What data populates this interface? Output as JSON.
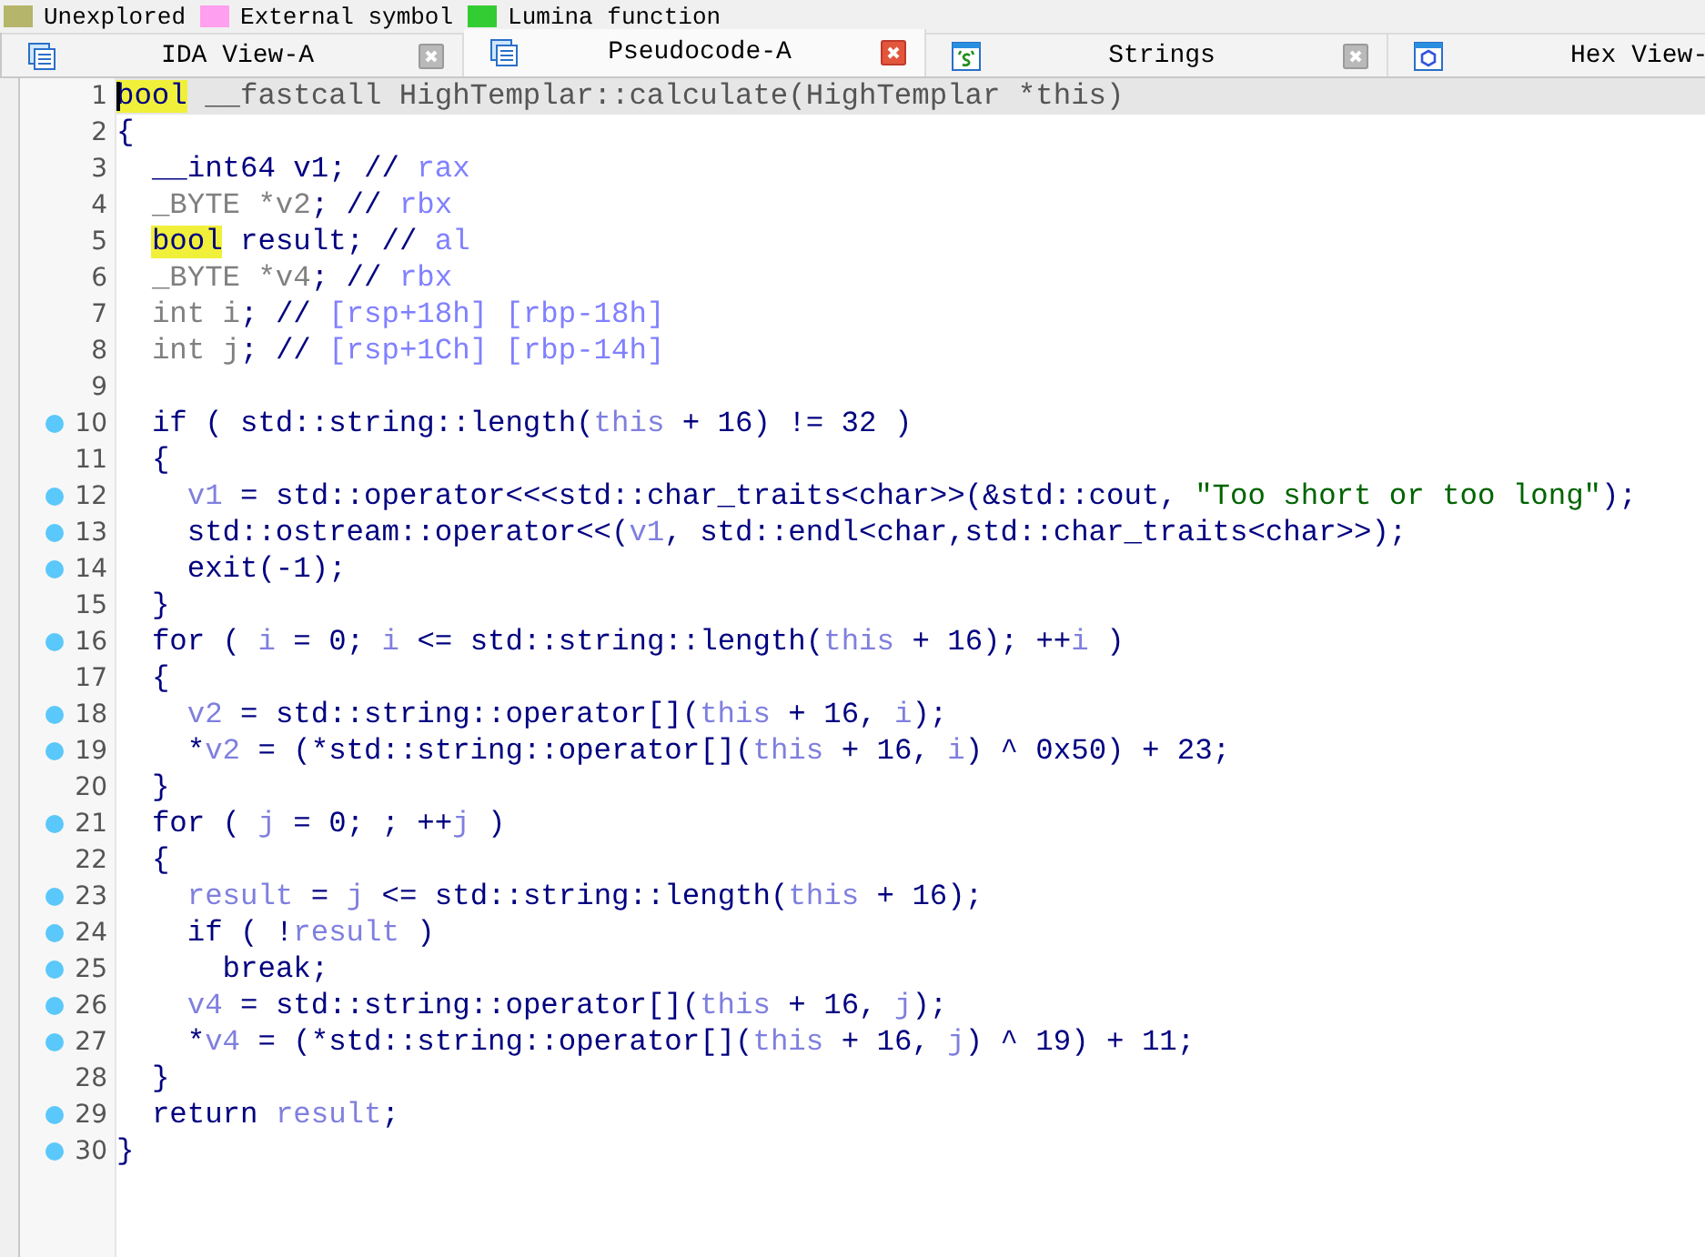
{
  "legend": [
    {
      "label": "Unexplored",
      "color": "#b5b56b"
    },
    {
      "label": "External symbol",
      "color": "#ff9fef"
    },
    {
      "label": "Lumina function",
      "color": "#33cc33"
    }
  ],
  "tabs": [
    {
      "label": "IDA View-A",
      "kind": "view",
      "selected": false,
      "close_button": true
    },
    {
      "label": "Pseudocode-A",
      "kind": "pseudocode",
      "selected": true,
      "close_button": true
    },
    {
      "label": "Strings",
      "kind": "strings",
      "selected": false,
      "close_button": true
    },
    {
      "label": "Hex View-",
      "kind": "hex",
      "selected": false,
      "close_button": false
    }
  ],
  "code_lines": [
    {
      "number": "1",
      "breakpoint": false,
      "selected": true,
      "segments": [
        {
          "kind": "highlight",
          "text": "bool"
        },
        {
          "kind": "decl",
          "text": " __fastcall HighTemplar::calculate(HighTemplar *this)"
        }
      ]
    },
    {
      "number": "2",
      "breakpoint": false,
      "selected": false,
      "segments": [
        {
          "kind": "plain",
          "text": "{"
        }
      ]
    },
    {
      "number": "3",
      "breakpoint": false,
      "selected": false,
      "segments": [
        {
          "kind": "plain",
          "text": "  __int64 v1; // "
        },
        {
          "kind": "comment",
          "text": "rax"
        }
      ]
    },
    {
      "number": "4",
      "breakpoint": false,
      "selected": false,
      "segments": [
        {
          "kind": "type",
          "text": "  _BYTE *v2"
        },
        {
          "kind": "plain",
          "text": "; // "
        },
        {
          "kind": "comment",
          "text": "rbx"
        }
      ]
    },
    {
      "number": "5",
      "breakpoint": false,
      "selected": false,
      "segments": [
        {
          "kind": "highlight",
          "text": "  bool"
        },
        {
          "kind": "plain",
          "text": " result; // "
        },
        {
          "kind": "comment",
          "text": "al"
        }
      ]
    },
    {
      "number": "6",
      "breakpoint": false,
      "selected": false,
      "segments": [
        {
          "kind": "type",
          "text": "  _BYTE *v4"
        },
        {
          "kind": "plain",
          "text": "; // "
        },
        {
          "kind": "comment",
          "text": "rbx"
        }
      ]
    },
    {
      "number": "7",
      "breakpoint": false,
      "selected": false,
      "segments": [
        {
          "kind": "type",
          "text": "  int i"
        },
        {
          "kind": "plain",
          "text": "; // "
        },
        {
          "kind": "comment",
          "text": "[rsp+18h] [rbp-18h]"
        }
      ]
    },
    {
      "number": "8",
      "breakpoint": false,
      "selected": false,
      "segments": [
        {
          "kind": "type",
          "text": "  int j"
        },
        {
          "kind": "plain",
          "text": "; // "
        },
        {
          "kind": "comment",
          "text": "[rsp+1Ch] [rbp-14h]"
        }
      ]
    },
    {
      "number": "9",
      "breakpoint": false,
      "selected": false
    },
    {
      "number": "10",
      "breakpoint": true,
      "selected": false,
      "segments": [
        {
          "kind": "plain",
          "text": "  if ( std::string::length("
        },
        {
          "kind": "var",
          "text": "this"
        },
        {
          "kind": "plain",
          "text": " + 16) != 32 )"
        }
      ]
    },
    {
      "number": "11",
      "breakpoint": false,
      "selected": false,
      "segments": [
        {
          "kind": "plain",
          "text": "  {"
        }
      ]
    },
    {
      "number": "12",
      "breakpoint": true,
      "selected": false,
      "segments": [
        {
          "kind": "var",
          "text": "    v1"
        },
        {
          "kind": "plain",
          "text": " = std::operator<<<std::char_traits<char>>(&std::cout, "
        },
        {
          "kind": "string",
          "text": "\"Too short or too long\""
        },
        {
          "kind": "plain",
          "text": ");"
        }
      ]
    },
    {
      "number": "13",
      "breakpoint": true,
      "selected": false,
      "segments": [
        {
          "kind": "plain",
          "text": "    std::ostream::operator<<("
        },
        {
          "kind": "var",
          "text": "v1"
        },
        {
          "kind": "plain",
          "text": ", std::endl<char,std::char_traits<char>>);"
        }
      ]
    },
    {
      "number": "14",
      "breakpoint": true,
      "selected": false,
      "segments": [
        {
          "kind": "plain",
          "text": "    exit(-1);"
        }
      ]
    },
    {
      "number": "15",
      "breakpoint": false,
      "selected": false,
      "segments": [
        {
          "kind": "plain",
          "text": "  }"
        }
      ]
    },
    {
      "number": "16",
      "breakpoint": true,
      "selected": false,
      "segments": [
        {
          "kind": "plain",
          "text": "  for ( "
        },
        {
          "kind": "var",
          "text": "i"
        },
        {
          "kind": "plain",
          "text": " = 0; "
        },
        {
          "kind": "var",
          "text": "i"
        },
        {
          "kind": "plain",
          "text": " <= std::string::length("
        },
        {
          "kind": "var",
          "text": "this"
        },
        {
          "kind": "plain",
          "text": " + 16); ++"
        },
        {
          "kind": "var",
          "text": "i"
        },
        {
          "kind": "plain",
          "text": " )"
        }
      ]
    },
    {
      "number": "17",
      "breakpoint": false,
      "selected": false,
      "segments": [
        {
          "kind": "plain",
          "text": "  {"
        }
      ]
    },
    {
      "number": "18",
      "breakpoint": true,
      "selected": false,
      "segments": [
        {
          "kind": "var",
          "text": "    v2"
        },
        {
          "kind": "plain",
          "text": " = std::string::operator[]("
        },
        {
          "kind": "var",
          "text": "this"
        },
        {
          "kind": "plain",
          "text": " + 16, "
        },
        {
          "kind": "var",
          "text": "i"
        },
        {
          "kind": "plain",
          "text": ");"
        }
      ]
    },
    {
      "number": "19",
      "breakpoint": true,
      "selected": false,
      "segments": [
        {
          "kind": "plain",
          "text": "    *"
        },
        {
          "kind": "var",
          "text": "v2"
        },
        {
          "kind": "plain",
          "text": " = (*std::string::operator[]("
        },
        {
          "kind": "var",
          "text": "this"
        },
        {
          "kind": "plain",
          "text": " + 16, "
        },
        {
          "kind": "var",
          "text": "i"
        },
        {
          "kind": "plain",
          "text": ") ^ 0x50) + 23;"
        }
      ]
    },
    {
      "number": "20",
      "breakpoint": false,
      "selected": false,
      "segments": [
        {
          "kind": "plain",
          "text": "  }"
        }
      ]
    },
    {
      "number": "21",
      "breakpoint": true,
      "selected": false,
      "segments": [
        {
          "kind": "plain",
          "text": "  for ( "
        },
        {
          "kind": "var",
          "text": "j"
        },
        {
          "kind": "plain",
          "text": " = 0; ; ++"
        },
        {
          "kind": "var",
          "text": "j"
        },
        {
          "kind": "plain",
          "text": " )"
        }
      ]
    },
    {
      "number": "22",
      "breakpoint": false,
      "selected": false,
      "segments": [
        {
          "kind": "plain",
          "text": "  {"
        }
      ]
    },
    {
      "number": "23",
      "breakpoint": true,
      "selected": false,
      "segments": [
        {
          "kind": "var",
          "text": "    result"
        },
        {
          "kind": "plain",
          "text": " = "
        },
        {
          "kind": "var",
          "text": "j"
        },
        {
          "kind": "plain",
          "text": " <= std::string::length("
        },
        {
          "kind": "var",
          "text": "this"
        },
        {
          "kind": "plain",
          "text": " + 16);"
        }
      ]
    },
    {
      "number": "24",
      "breakpoint": true,
      "selected": false,
      "segments": [
        {
          "kind": "plain",
          "text": "    if ( !"
        },
        {
          "kind": "var",
          "text": "result"
        },
        {
          "kind": "plain",
          "text": " )"
        }
      ]
    },
    {
      "number": "25",
      "breakpoint": true,
      "selected": false,
      "segments": [
        {
          "kind": "plain",
          "text": "      break;"
        }
      ]
    },
    {
      "number": "26",
      "breakpoint": true,
      "selected": false,
      "segments": [
        {
          "kind": "var",
          "text": "    v4"
        },
        {
          "kind": "plain",
          "text": " = std::string::operator[]("
        },
        {
          "kind": "var",
          "text": "this"
        },
        {
          "kind": "plain",
          "text": " + 16, "
        },
        {
          "kind": "var",
          "text": "j"
        },
        {
          "kind": "plain",
          "text": ");"
        }
      ]
    },
    {
      "number": "27",
      "breakpoint": true,
      "selected": false,
      "segments": [
        {
          "kind": "plain",
          "text": "    *"
        },
        {
          "kind": "var",
          "text": "v4"
        },
        {
          "kind": "plain",
          "text": " = (*std::string::operator[]("
        },
        {
          "kind": "var",
          "text": "this"
        },
        {
          "kind": "plain",
          "text": " + 16, "
        },
        {
          "kind": "var",
          "text": "j"
        },
        {
          "kind": "plain",
          "text": ") ^ 19) + 11;"
        }
      ]
    },
    {
      "number": "28",
      "breakpoint": false,
      "selected": false,
      "segments": [
        {
          "kind": "plain",
          "text": "  }"
        }
      ]
    },
    {
      "number": "29",
      "breakpoint": true,
      "selected": false,
      "segments": [
        {
          "kind": "plain",
          "text": "  return "
        },
        {
          "kind": "var",
          "text": "result"
        },
        {
          "kind": "plain",
          "text": ";"
        }
      ]
    },
    {
      "number": "30",
      "breakpoint": true,
      "selected": false,
      "segments": [
        {
          "kind": "plain",
          "text": "}"
        }
      ]
    }
  ]
}
